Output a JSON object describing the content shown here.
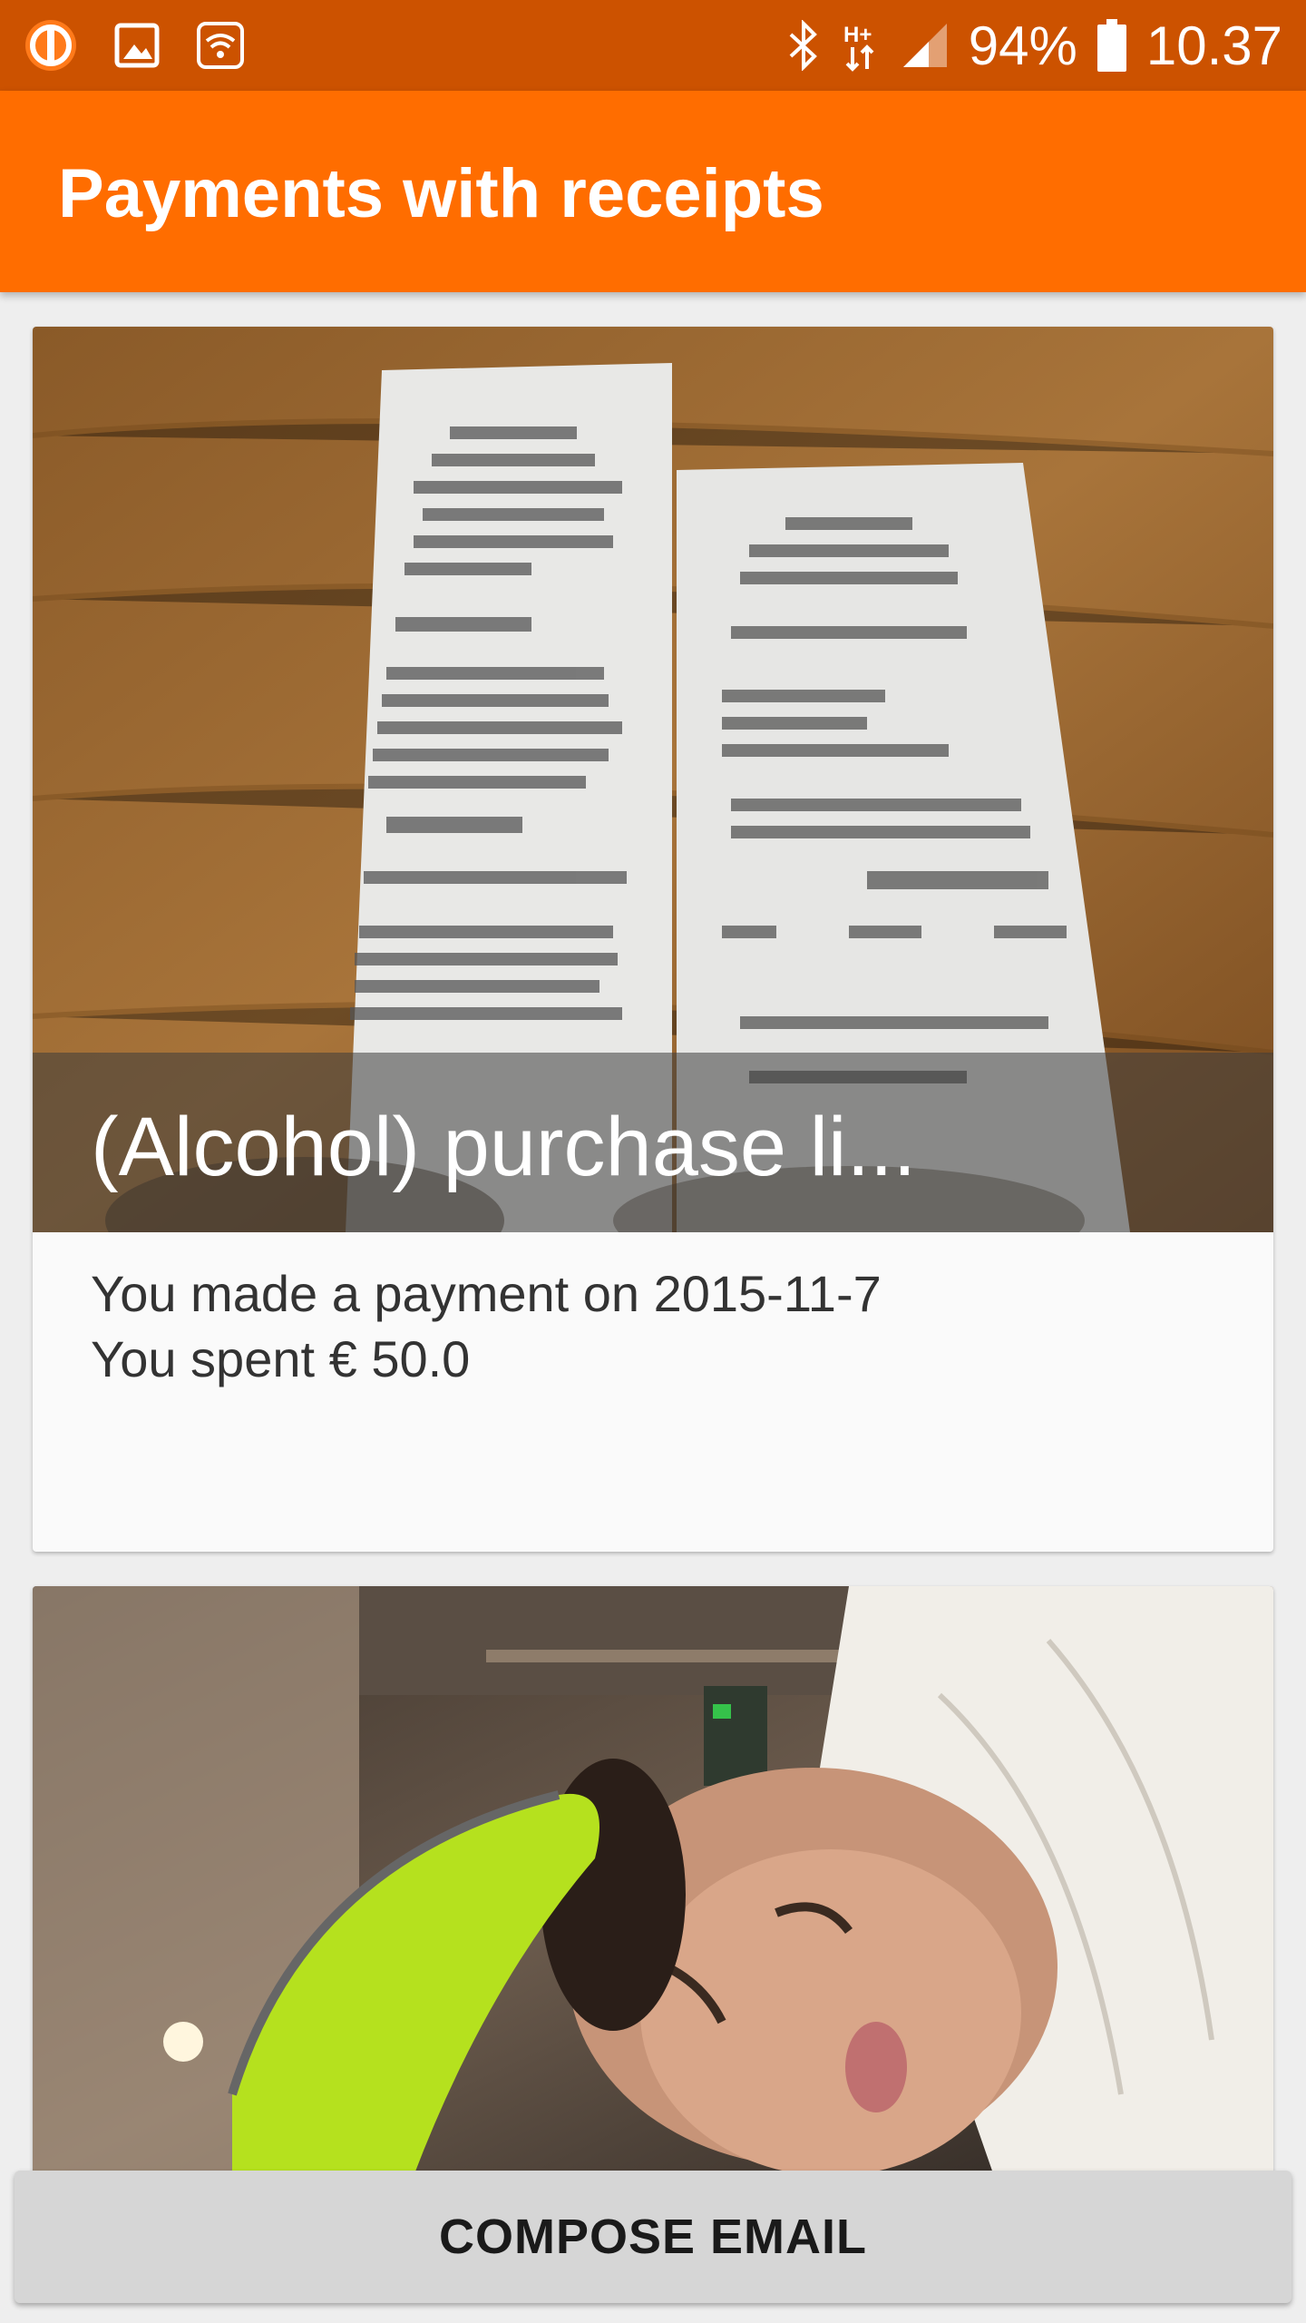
{
  "status_bar": {
    "battery_percent": "94%",
    "time": "10.37",
    "network": "H+",
    "icons": [
      "app-notification-icon",
      "image-notification-icon",
      "wifi-calling-icon",
      "bluetooth-icon",
      "signal-icon",
      "battery-icon"
    ]
  },
  "app_bar": {
    "title": "Payments with receipts"
  },
  "cards": [
    {
      "caption": "(Alcohol) purchase li...",
      "line1": "You made a payment on 2015-11-7",
      "line2": "You spent € 50.0"
    }
  ],
  "actions": {
    "compose_label": "COMPOSE EMAIL"
  },
  "colors": {
    "status_bar": "#cc5200",
    "app_bar": "#ff6d00",
    "background": "#eeeeee",
    "button": "#d6d6d6"
  }
}
